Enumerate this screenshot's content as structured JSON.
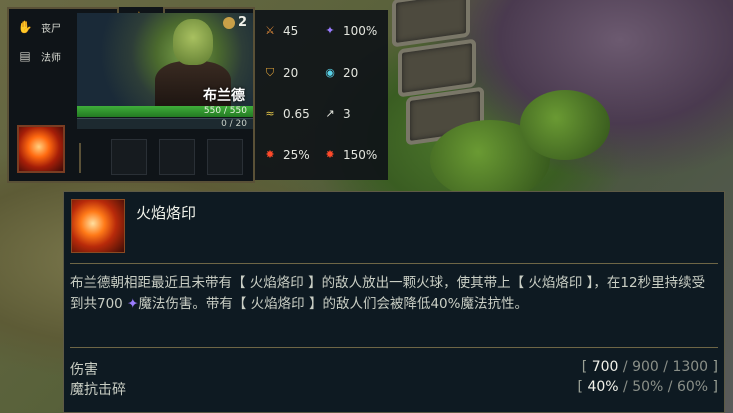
{
  "unit": {
    "traits": [
      {
        "icon": "hand-icon",
        "label": "丧尸"
      },
      {
        "icon": "book-icon",
        "label": "法师"
      }
    ],
    "cost": "2",
    "name": "布兰德",
    "hp": "550 / 550",
    "mana": "0 / 20"
  },
  "stats": {
    "attack_damage": "45",
    "ability_power": "100%",
    "armor": "20",
    "magic_resist": "20",
    "attack_speed": "0.65",
    "range": "3",
    "crit_chance": "25%",
    "crit_damage": "150%"
  },
  "ability": {
    "name": "火焰烙印",
    "desc_part1": "布兰德朝相距最近且未带有【 火焰烙印 】的敌人放出一颗火球，使其带上【 火焰烙印 】，在12秒里持续受到共700 ",
    "desc_magic": "魔法伤害",
    "desc_part2": "。带有【 火焰烙印 】的敌人们会被降低40%魔法抗性。",
    "rows": [
      {
        "label": "伤害",
        "cur": "700",
        "v2": "900",
        "v3": "1300"
      },
      {
        "label": "魔抗击碎",
        "cur": "40%",
        "v2": "50%",
        "v3": "60%"
      }
    ]
  },
  "colors": {
    "hp_bar": "#3fae3a",
    "magic_damage": "#9a7cff",
    "border_gold": "#5a5137"
  }
}
